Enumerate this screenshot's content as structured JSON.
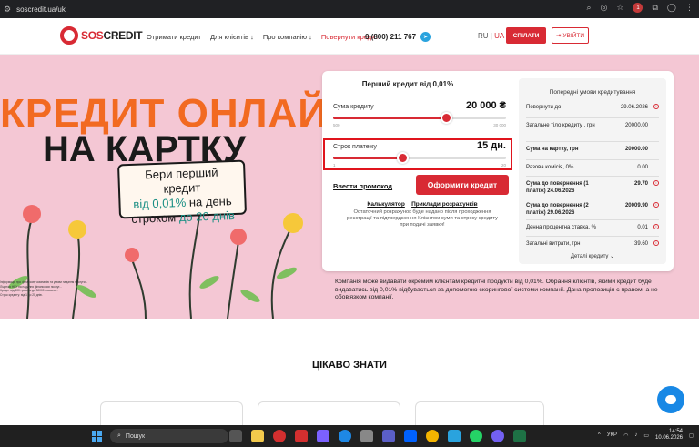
{
  "browser": {
    "url": "soscredit.ua/uk",
    "profile_badge": "1"
  },
  "header": {
    "logo_sos": "SOS",
    "logo_credit": "CREDIT",
    "nav": [
      "Отримати кредит",
      "Для клієнтів ↓",
      "Про компанію ↓",
      "Повернути кредит"
    ],
    "phone": "0 (800) 211 767",
    "lang_ru": "RU",
    "lang_sep": "|",
    "lang_ua": "UA",
    "signup": "СПІЛАТИ",
    "login": "УВІЙТИ"
  },
  "hero": {
    "title1": "КРЕДИТ ОНЛАЙН",
    "title2": "НА КАРТКУ",
    "offer_l1": "Бери перший кредит",
    "offer_l2a": "від 0,01%",
    "offer_l2b": " на день",
    "offer_l3a": "строком ",
    "offer_l3b": "до 20 днів"
  },
  "calc": {
    "title": "Перший кредит від 0,01%",
    "amount_label": "Сума кредиту",
    "amount_value": "20 000 ₴",
    "amount_min": "500",
    "amount_max": "30 000",
    "amount_fraction": 0.65,
    "term_label": "Строк платежу",
    "term_value": "15 дн.",
    "term_min": "1",
    "term_max": "20",
    "term_fraction": 0.4,
    "promo": "Ввести промокод",
    "apply": "Оформити кредит",
    "link_calc": "Калькулятор",
    "link_examples": "Приклади розрахунків",
    "note": "Остаточний розрахунок буде надано після проходження реєстрації та підтвердження Клієнтом суми та строку кредиту при подачі заявки!"
  },
  "terms": {
    "title": "Попередні умови кредитування",
    "rows": [
      {
        "k": "Повернути до",
        "v": "29.06.2026",
        "bold": false
      },
      {
        "k": "Загальне тіло кредиту , грн",
        "v": "20000.00",
        "bold": false
      },
      {
        "k": "Сума на картку, грн",
        "v": "20000.00",
        "bold": true
      },
      {
        "k": "Разова комісія, 0%",
        "v": "0.00",
        "bold": false
      },
      {
        "k": "Сума до повернення (1 платіж) 24.06.2026",
        "v": "29.70",
        "bold": true
      },
      {
        "k": "Сума до повернення (2 платіж) 29.06.2026",
        "v": "20009.90",
        "bold": true
      },
      {
        "k": "Денна процентна ставка, %",
        "v": "0.01",
        "bold": false
      },
      {
        "k": "Загальні витрати, грн",
        "v": "39.60",
        "bold": false
      }
    ],
    "details": "Деталі кредиту ⌄"
  },
  "company_note": "Компанія може видавати окремим клієнтам кредитні продукти від 0,01%. Обрання клієнтів, якими кредит буде видаватись від 0,01% відбувається за допомогою скорингової системи компанії. Дана пропозиція є правом, а не обов'язком компанії.",
  "section_title": "ЦІКАВО ЗНАТИ",
  "taskbar": {
    "search": "Пошук",
    "lang": "УКР",
    "time": "14:54",
    "date": "10.06.2026"
  },
  "colors": {
    "brand_red": "#d82a34",
    "hero_pink": "#f4c7d4",
    "hero_orange": "#f26a21",
    "highlight": "#e0141d"
  }
}
